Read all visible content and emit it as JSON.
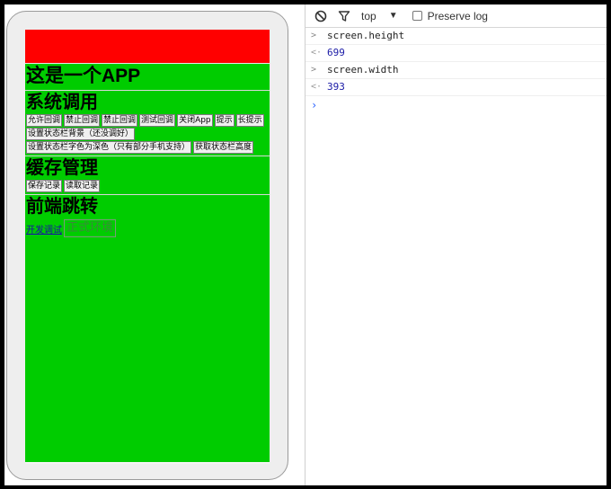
{
  "app": {
    "title": "这是一个APP",
    "sections": {
      "system": {
        "heading": "系统调用",
        "buttons": [
          "允许回调",
          "禁止回调",
          "禁止回调",
          "测试回调",
          "关闭App",
          "提示",
          "长提示",
          "设置状态栏背景（还没调好）",
          "设置状态栏字色为深色（只有部分手机支持）",
          "获取状态栏高度"
        ]
      },
      "cache": {
        "heading": "缓存管理",
        "buttons": [
          "保存记录",
          "读取记录"
        ]
      },
      "nav": {
        "heading": "前端跳转",
        "dev_link": "开发调试",
        "prod_button": "正式环境"
      }
    },
    "colors": {
      "status_bar": "#ff0000",
      "body": "#00cc00"
    }
  },
  "devtools": {
    "toolbar": {
      "clear_icon": "block-icon",
      "filter_icon": "filter-icon",
      "context": "top",
      "preserve_log": "Preserve log"
    },
    "console": [
      {
        "type": "input",
        "text": "screen.height"
      },
      {
        "type": "result",
        "text": "699"
      },
      {
        "type": "input",
        "text": "screen.width"
      },
      {
        "type": "result",
        "text": "393"
      }
    ]
  }
}
